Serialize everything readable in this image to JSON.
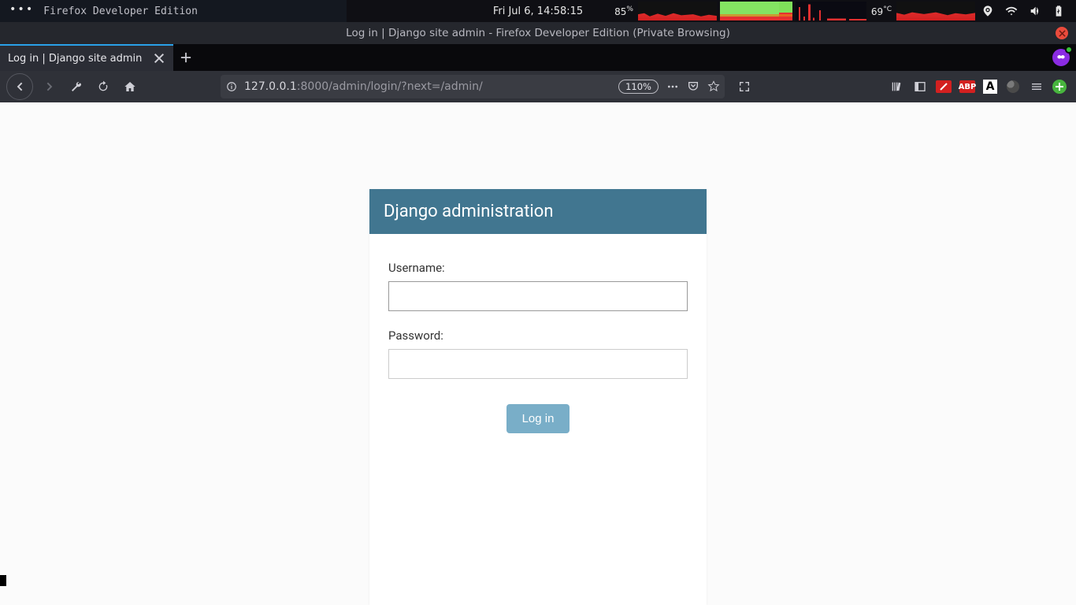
{
  "desktop": {
    "app_left_label": "Firefox Developer Edition",
    "clock": "Fri Jul  6, 14:58:15",
    "battery_pct": "85",
    "battery_unit": "%",
    "temp_val": "69",
    "temp_unit": "°C"
  },
  "firefox": {
    "window_title": "Log in | Django site admin - Firefox Developer Edition (Private Browsing)",
    "tab_title": "Log in | Django site admin",
    "url_host": "127.0.0.1",
    "url_port_path": ":8000/admin/login/?next=/admin/",
    "zoom": "110%",
    "ext_abp": "ABP",
    "ext_a": "A"
  },
  "django": {
    "header": "Django administration",
    "username_label": "Username:",
    "password_label": "Password:",
    "login_button": "Log in"
  }
}
